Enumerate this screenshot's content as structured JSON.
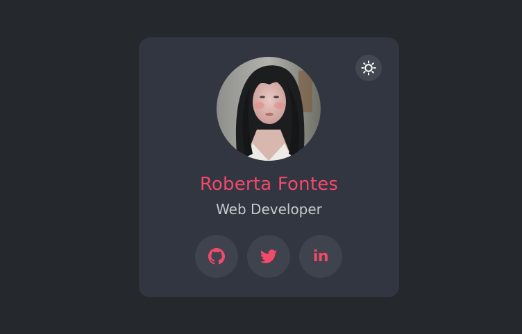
{
  "profile": {
    "name": "Roberta Fontes",
    "role": "Web Developer"
  },
  "socials": {
    "linkedin_text": "in"
  },
  "colors": {
    "background": "#25282d",
    "card": "#323640",
    "accent": "#f24a6b",
    "button": "#3e434d",
    "subtitle": "#c7c9ce"
  },
  "icons": {
    "theme_toggle": "sun-icon",
    "github": "github-icon",
    "twitter": "twitter-icon",
    "linkedin": "linkedin-icon"
  }
}
